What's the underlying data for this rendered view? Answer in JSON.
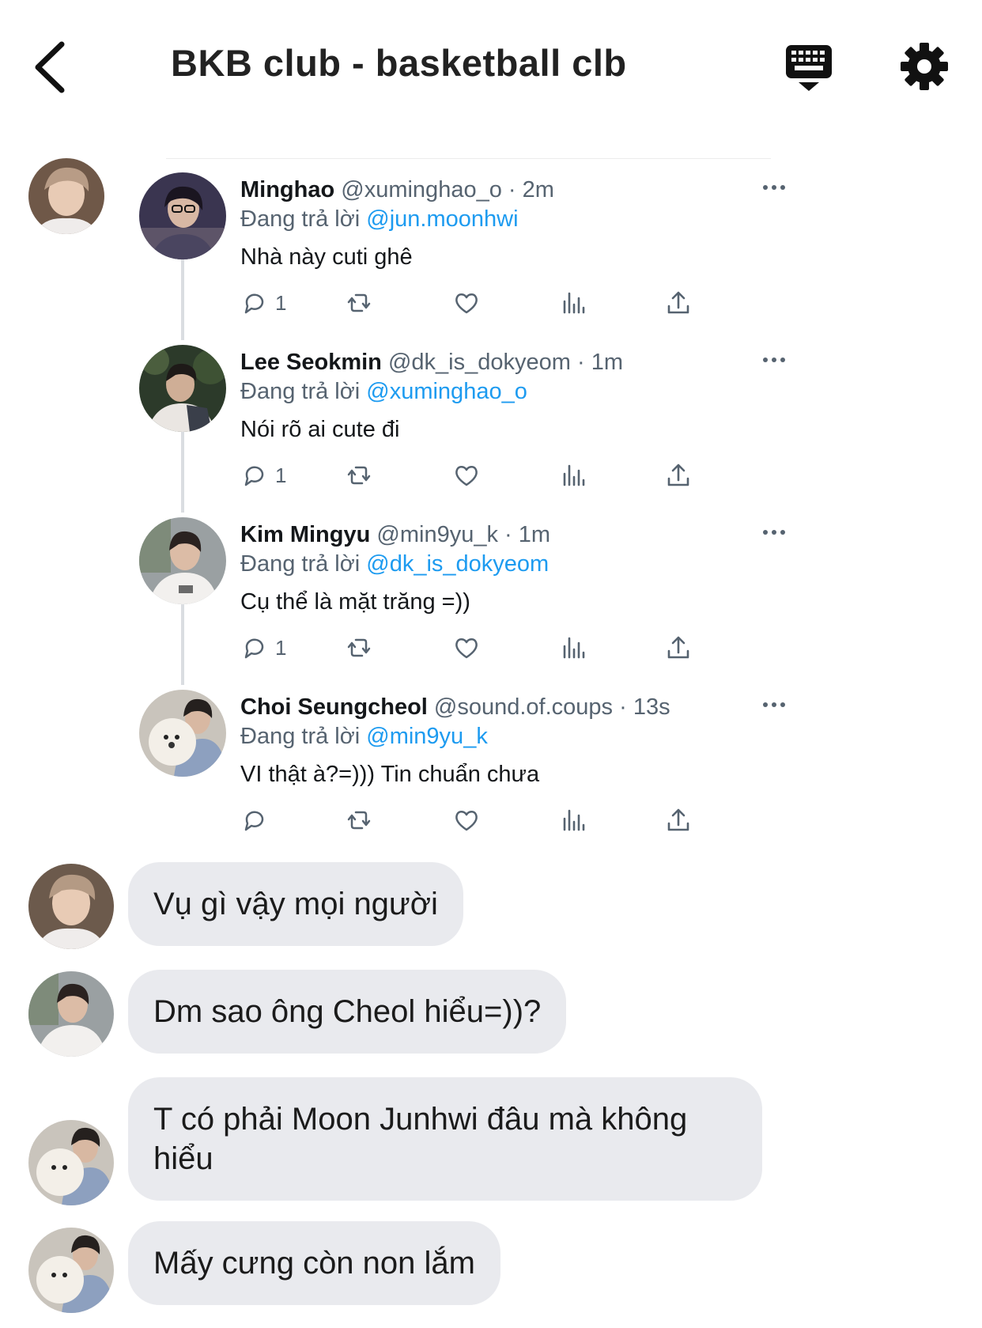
{
  "header": {
    "title": "BKB club - basketball clb"
  },
  "thread": [
    {
      "name": "Minghao",
      "handle": "@xuminghao_o",
      "time": "2m",
      "reply_label": "Đang trả lời",
      "reply_to": "@jun.moonhwi",
      "text": "Nhà này cuti ghê",
      "reply_count": "1"
    },
    {
      "name": "Lee Seokmin",
      "handle": "@dk_is_dokyeom",
      "time": "1m",
      "reply_label": "Đang trả lời",
      "reply_to": "@xuminghao_o",
      "text": "Nói rõ ai cute đi",
      "reply_count": "1"
    },
    {
      "name": "Kim Mingyu",
      "handle": "@min9yu_k",
      "time": "1m",
      "reply_label": "Đang trả lời",
      "reply_to": "@dk_is_dokyeom",
      "text": "Cụ thể là mặt trăng =))",
      "reply_count": "1"
    },
    {
      "name": "Choi Seungcheol",
      "handle": "@sound.of.coups",
      "time": "13s",
      "reply_label": "Đang trả lời",
      "reply_to": "@min9yu_k",
      "text": "VI thật à?=))) Tin chuẩn chưa",
      "reply_count": ""
    }
  ],
  "messages": [
    {
      "text": "Vụ gì vậy mọi người"
    },
    {
      "text": "Dm sao ông Cheol hiểu=))?"
    },
    {
      "text": "T có phải Moon Junhwi đâu mà không hiểu"
    },
    {
      "text": "Mấy cưng còn non lắm"
    }
  ],
  "icons": {
    "back": "chevron-left-icon",
    "keyboard": "keyboard-icon",
    "settings": "gear-icon",
    "reply": "reply-icon",
    "retweet": "retweet-icon",
    "like": "heart-icon",
    "views": "stats-icon",
    "share": "share-icon",
    "more": "more-icon"
  },
  "colors": {
    "mention": "#1d9bf0",
    "bubble": "#e9eaee",
    "muted": "#566370"
  }
}
